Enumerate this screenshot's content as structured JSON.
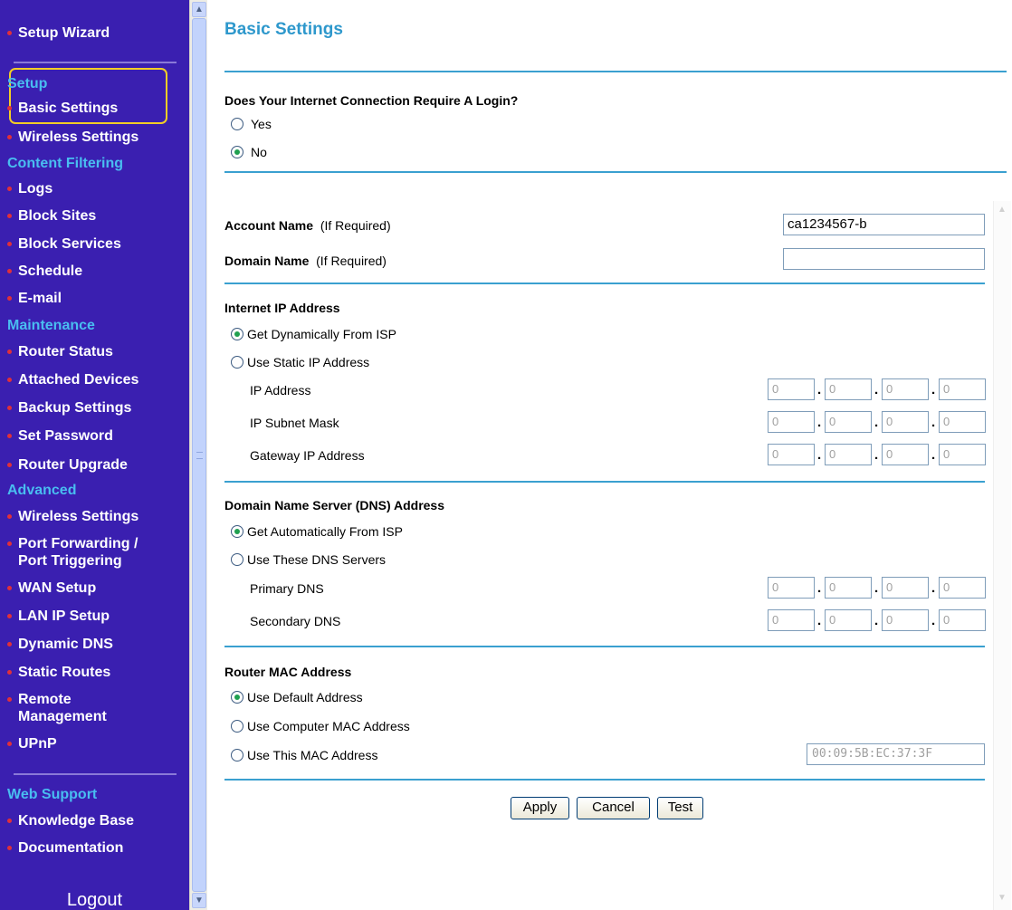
{
  "sidebar": {
    "setup_wizard": "Setup Wizard",
    "sections": {
      "setup": "Setup",
      "content_filtering": "Content Filtering",
      "maintenance": "Maintenance",
      "advanced": "Advanced",
      "web_support": "Web Support"
    },
    "items": {
      "basic_settings": "Basic Settings",
      "wireless_settings": "Wireless Settings",
      "logs": "Logs",
      "block_sites": "Block Sites",
      "block_services": "Block Services",
      "schedule": "Schedule",
      "email": "E-mail",
      "router_status": "Router Status",
      "attached_devices": "Attached Devices",
      "backup_settings": "Backup Settings",
      "set_password": "Set Password",
      "router_upgrade": "Router Upgrade",
      "adv_wireless_settings": "Wireless Settings",
      "port_forwarding_1": "Port Forwarding /",
      "port_forwarding_2": "Port Triggering",
      "wan_setup": "WAN Setup",
      "lan_ip_setup": "LAN IP Setup",
      "dynamic_dns": "Dynamic DNS",
      "static_routes": "Static Routes",
      "remote_management_1": "Remote",
      "remote_management_2": "Management",
      "upnp": "UPnP",
      "knowledge_base": "Knowledge Base",
      "documentation": "Documentation"
    },
    "logout": "Logout"
  },
  "main": {
    "title": "Basic Settings",
    "login_question": "Does Your Internet Connection Require A Login?",
    "login_yes": "Yes",
    "login_no": "No",
    "login_selected": "No",
    "account_name_label": "Account Name",
    "domain_name_label": "Domain Name",
    "if_required": "(If Required)",
    "account_name_value": "ca1234567-b",
    "domain_name_value": "",
    "internet_ip": {
      "heading": "Internet IP Address",
      "option_dynamic": "Get Dynamically From ISP",
      "option_static": "Use Static IP Address",
      "selected": "Get Dynamically From ISP",
      "ip_address_label": "IP Address",
      "subnet_mask_label": "IP Subnet Mask",
      "gateway_label": "Gateway IP Address",
      "ip_address": [
        "0",
        "0",
        "0",
        "0"
      ],
      "subnet_mask": [
        "0",
        "0",
        "0",
        "0"
      ],
      "gateway": [
        "0",
        "0",
        "0",
        "0"
      ]
    },
    "dns": {
      "heading": "Domain Name Server (DNS) Address",
      "option_auto": "Get Automatically From ISP",
      "option_manual": "Use These DNS Servers",
      "selected": "Get Automatically From ISP",
      "primary_label": "Primary DNS",
      "secondary_label": "Secondary DNS",
      "primary": [
        "0",
        "0",
        "0",
        "0"
      ],
      "secondary": [
        "0",
        "0",
        "0",
        "0"
      ]
    },
    "mac": {
      "heading": "Router MAC Address",
      "option_default": "Use Default Address",
      "option_computer": "Use Computer MAC Address",
      "option_this": "Use This MAC Address",
      "selected": "Use Default Address",
      "value": "00:09:5B:EC:37:3F"
    },
    "buttons": {
      "apply": "Apply",
      "cancel": "Cancel",
      "test": "Test"
    }
  },
  "colors": {
    "sidebar_bg": "#3a1fb0",
    "section_heading": "#49bdf0",
    "title": "#2e98cc",
    "divider": "#3aa0d0",
    "highlight": "#f2ce26",
    "bullet": "#e0303a"
  },
  "icons": {
    "scroll_up": "chevron-up-icon",
    "scroll_down": "chevron-down-icon"
  }
}
